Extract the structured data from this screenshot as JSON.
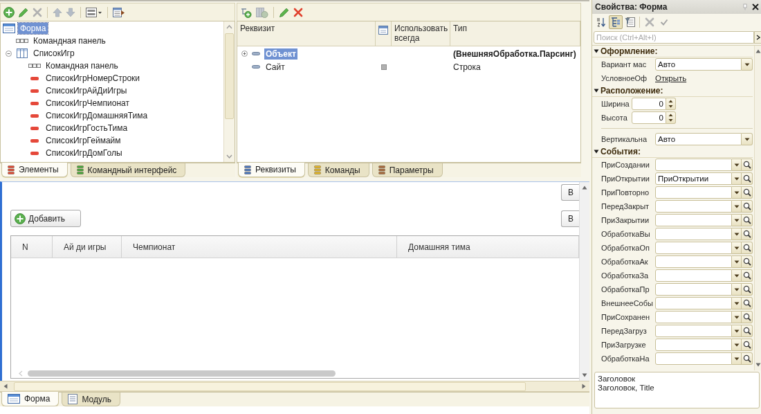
{
  "elements_panel": {
    "tree": [
      {
        "label": "Форма",
        "kind": "form",
        "selected": true,
        "children": [
          {
            "label": "Командная панель",
            "kind": "command_panel",
            "selected": false
          },
          {
            "label": "СписокИгр",
            "kind": "table",
            "selected": false,
            "expanded": true,
            "children": [
              {
                "label": "Командная панель",
                "kind": "command_panel",
                "selected": false
              },
              {
                "label": "СписокИгрНомерСтроки",
                "kind": "field",
                "selected": false
              },
              {
                "label": "СписокИгрАйДиИгры",
                "kind": "field",
                "selected": false
              },
              {
                "label": "СписокИгрЧемпионат",
                "kind": "field",
                "selected": false
              },
              {
                "label": "СписокИгрДомашняяТима",
                "kind": "field",
                "selected": false
              },
              {
                "label": "СписокИгрГостьТима",
                "kind": "field",
                "selected": false
              },
              {
                "label": "СписокИгрГеймайм",
                "kind": "field",
                "selected": false
              },
              {
                "label": "СписокИгрДомГолы",
                "kind": "field",
                "selected": false
              }
            ]
          }
        ]
      }
    ],
    "tabs": [
      {
        "label": "Элементы",
        "kind": "elements",
        "selected": true
      },
      {
        "label": "Командный интерфейс",
        "kind": "command_interface",
        "selected": false
      }
    ]
  },
  "attributes_panel": {
    "columns": [
      "Реквизит",
      "Использовать всегда",
      "Тип"
    ],
    "rows": [
      {
        "name": "Объект",
        "type": "(ВнешняяОбработка.Парсинг)",
        "kind": "main",
        "selected": true,
        "expanded": false,
        "flagged": false
      },
      {
        "name": "Сайт",
        "type": "Строка",
        "kind": "plain",
        "selected": false,
        "flagged": true
      }
    ],
    "tabs": [
      {
        "label": "Реквизиты",
        "kind": "attributes",
        "selected": true
      },
      {
        "label": "Команды",
        "kind": "commands",
        "selected": false
      },
      {
        "label": "Параметры",
        "kind": "parameters",
        "selected": false
      }
    ]
  },
  "form_editor": {
    "top_button": "В",
    "add_button": "Добавить",
    "side_button": "В",
    "table": {
      "columns": [
        "N",
        "Ай ди игры",
        "Чемпионат",
        "Домашняя тима"
      ]
    },
    "tabs": [
      {
        "label": "Форма",
        "kind": "form",
        "selected": true
      },
      {
        "label": "Модуль",
        "kind": "module",
        "selected": false
      }
    ]
  },
  "properties": {
    "title": "Свойства: Форма",
    "view_buttons": [
      {
        "kind": "sort",
        "selected": false
      },
      {
        "kind": "categories",
        "selected": true
      },
      {
        "kind": "filter",
        "selected": false
      }
    ],
    "search": {
      "placeholder": "Поиск (Ctrl+Alt+I)"
    },
    "sections": [
      {
        "title": "Оформление:",
        "expanded": true,
        "rows": [
          {
            "kind": "select",
            "label": "Вариант мас",
            "value": "Авто"
          },
          {
            "kind": "link",
            "label": "УсловноеОф",
            "value": "Открыть"
          }
        ]
      },
      {
        "title": "Расположение:",
        "expanded": true,
        "rows": [
          {
            "kind": "number",
            "label": "Ширина",
            "value": "0"
          },
          {
            "kind": "number",
            "label": "Высота",
            "value": "0"
          },
          {
            "kind": "divider"
          },
          {
            "kind": "select",
            "label": "Вертикальна",
            "value": "Авто"
          }
        ]
      },
      {
        "title": "События:",
        "expanded": true,
        "rows": [
          {
            "kind": "event",
            "label": "ПриСоздании"
          },
          {
            "kind": "event",
            "label": "ПриОткрытии",
            "value": "ПриОткрытии"
          },
          {
            "kind": "event",
            "label": "ПриПовторно"
          },
          {
            "kind": "event",
            "label": "ПередЗакрыт"
          },
          {
            "kind": "event",
            "label": "ПриЗакрытии"
          },
          {
            "kind": "event",
            "label": "ОбработкаВы"
          },
          {
            "kind": "event",
            "label": "ОбработкаОп"
          },
          {
            "kind": "event",
            "label": "ОбработкаАк"
          },
          {
            "kind": "event",
            "label": "ОбработкаЗа"
          },
          {
            "kind": "event",
            "label": "ОбработкаПр"
          },
          {
            "kind": "event",
            "label": "ВнешнееСобы"
          },
          {
            "kind": "event",
            "label": "ПриСохранен"
          },
          {
            "kind": "event",
            "label": "ПередЗагруз"
          },
          {
            "kind": "event",
            "label": "ПриЗагрузке"
          },
          {
            "kind": "event",
            "label": "ОбработкаНа"
          }
        ]
      }
    ],
    "description": {
      "title": "Заголовок",
      "text": "Заголовок, Title"
    }
  }
}
